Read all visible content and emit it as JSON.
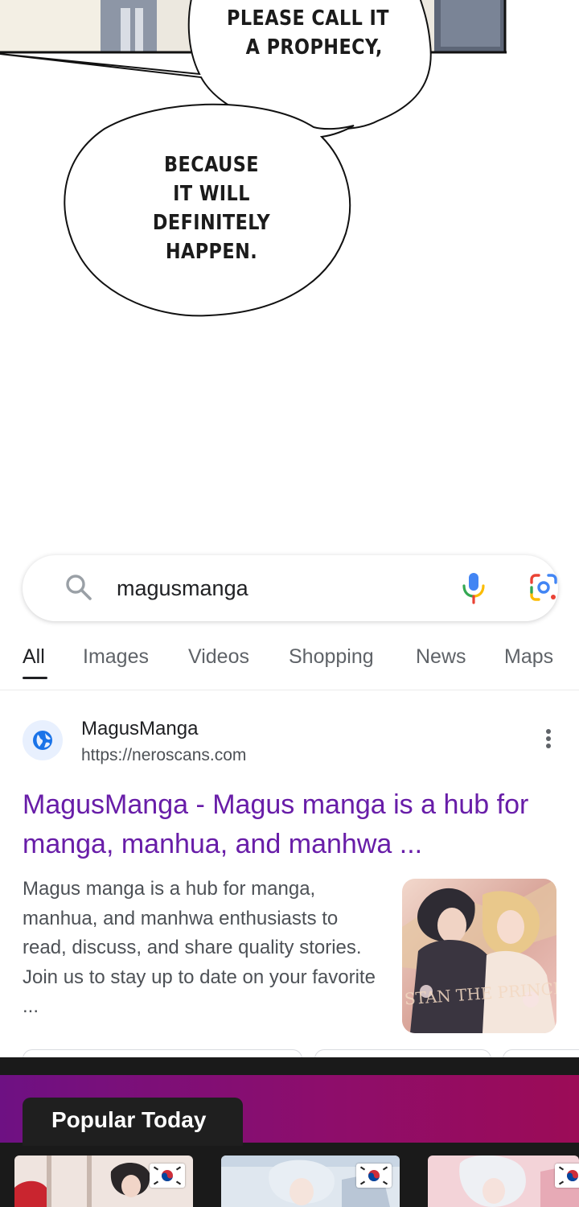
{
  "comic": {
    "bubble_top_lines": [
      "PLEASE CALL IT",
      "A PROPHECY,"
    ],
    "bubble_bottom_lines": [
      "BECAUSE",
      "IT WILL DEFINITELY",
      "HAPPEN."
    ]
  },
  "search": {
    "query": "magusmanga",
    "icons": {
      "search": "search-icon",
      "mic": "microphone-icon",
      "lens": "google-lens-icon"
    }
  },
  "tabs": [
    {
      "label": "All",
      "active": true
    },
    {
      "label": "Images"
    },
    {
      "label": "Videos"
    },
    {
      "label": "Shopping"
    },
    {
      "label": "News"
    },
    {
      "label": "Maps"
    }
  ],
  "result": {
    "site_name": "MagusManga",
    "url": "https://neroscans.com",
    "title": "MagusManga - Magus manga is a hub for manga, manhua, and manhwa ...",
    "snippet": "Magus manga is a hub for manga, manhua, and manhwa enthusiasts to read, discuss, and share quality stories. Join us to stay up to date on your favorite ...",
    "thumbnail_text": "I STAN THE PRINCE",
    "favicon_icon": "globe-icon",
    "title_color": "#681da8"
  },
  "popular": {
    "title": "Popular Today",
    "cards": [
      {
        "flag": "south-korea-flag"
      },
      {
        "flag": "south-korea-flag"
      },
      {
        "flag": "south-korea-flag"
      }
    ],
    "gradient_colors": [
      "#6e1183",
      "#9c0c57"
    ]
  }
}
